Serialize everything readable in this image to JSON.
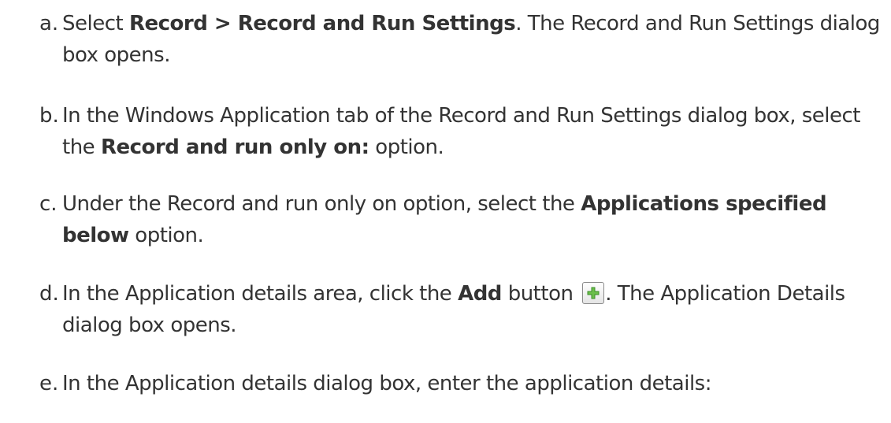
{
  "steps": [
    {
      "marker": "a.",
      "lines": [
        [
          {
            "t": "Select ",
            "b": false
          },
          {
            "t": "Record > Record and Run Settings",
            "b": true
          },
          {
            "t": ". The Record and Run Settings dialog",
            "b": false
          }
        ],
        [
          {
            "t": "box opens.",
            "b": false
          }
        ]
      ]
    },
    {
      "marker": "b.",
      "lines": [
        [
          {
            "t": "In the Windows Application tab of the Record and Run Settings dialog box, select",
            "b": false
          }
        ],
        [
          {
            "t": "the ",
            "b": false
          },
          {
            "t": "Record and run only on:",
            "b": true
          },
          {
            "t": " option.",
            "b": false
          }
        ]
      ]
    },
    {
      "marker": "c.",
      "lines": [
        [
          {
            "t": "Under the Record and run only on option, select the ",
            "b": false
          },
          {
            "t": "Applications specified",
            "b": true
          }
        ],
        [
          {
            "t": "below",
            "b": true
          },
          {
            "t": " option.",
            "b": false
          }
        ]
      ]
    },
    {
      "marker": "d.",
      "lines": [
        [
          {
            "t": "In the Application details area, click the ",
            "b": false
          },
          {
            "t": "Add",
            "b": true
          },
          {
            "t": " button ",
            "b": false
          },
          {
            "icon": "add-icon"
          },
          {
            "t": ". The Application Details",
            "b": false
          }
        ],
        [
          {
            "t": "dialog box opens.",
            "b": false
          }
        ]
      ]
    },
    {
      "marker": "e.",
      "lines": [
        [
          {
            "t": "In the Application details dialog box, enter the application details:",
            "b": false
          }
        ]
      ]
    }
  ],
  "colors": {
    "text": "#333333",
    "icon_plus": "#6bbf4a",
    "icon_plus_dark": "#3d8f2b"
  }
}
